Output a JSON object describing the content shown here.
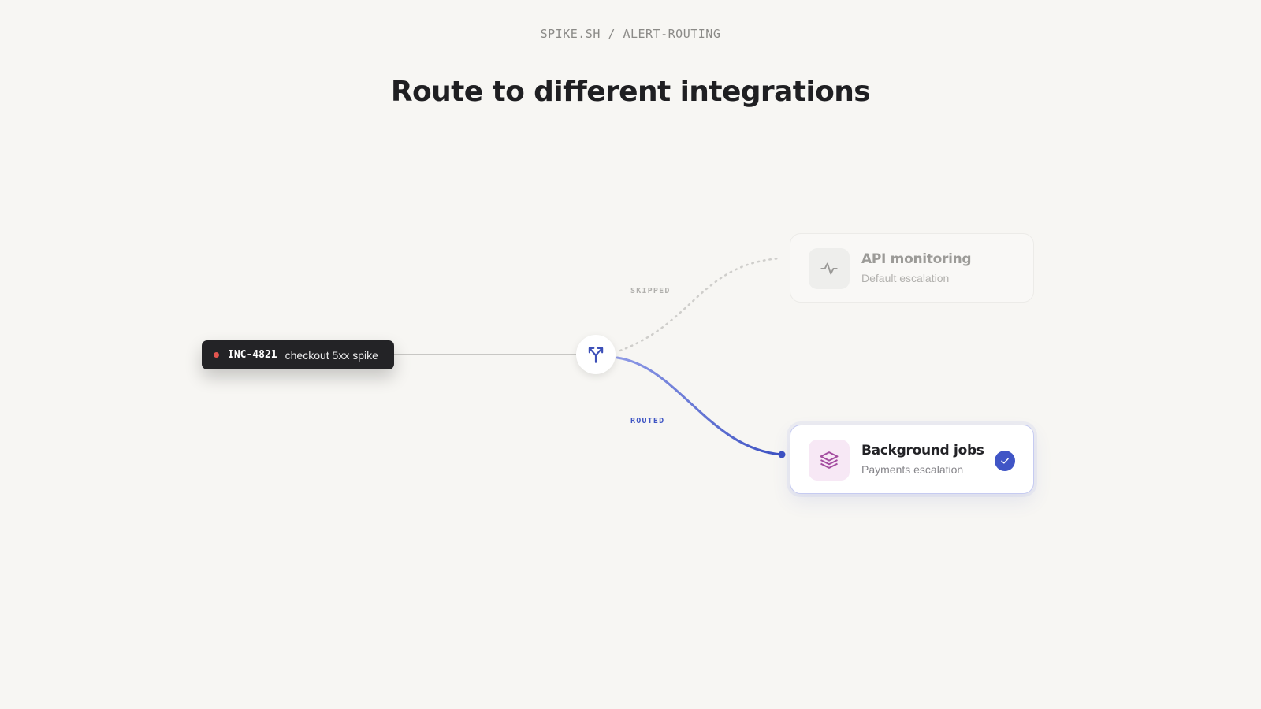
{
  "header": {
    "breadcrumb": "SPIKE.SH / ALERT-ROUTING",
    "title": "Route to different integrations"
  },
  "incident": {
    "id": "INC-4821",
    "description": "checkout 5xx spike",
    "status_color": "#e2554f"
  },
  "router": {
    "icon": "split-arrow-icon"
  },
  "edges": {
    "skipped_label": "SKIPPED",
    "routed_label": "ROUTED"
  },
  "integrations": [
    {
      "title": "API monitoring",
      "subtitle": "Default escalation",
      "icon": "activity-pulse-icon",
      "state": "skipped"
    },
    {
      "title": "Background jobs",
      "subtitle": "Payments escalation",
      "icon": "layers-stack-icon",
      "state": "routed",
      "selected": true
    }
  ],
  "colors": {
    "accent": "#4055c6",
    "skipped": "#c9c8c5",
    "background": "#f7f6f3"
  }
}
